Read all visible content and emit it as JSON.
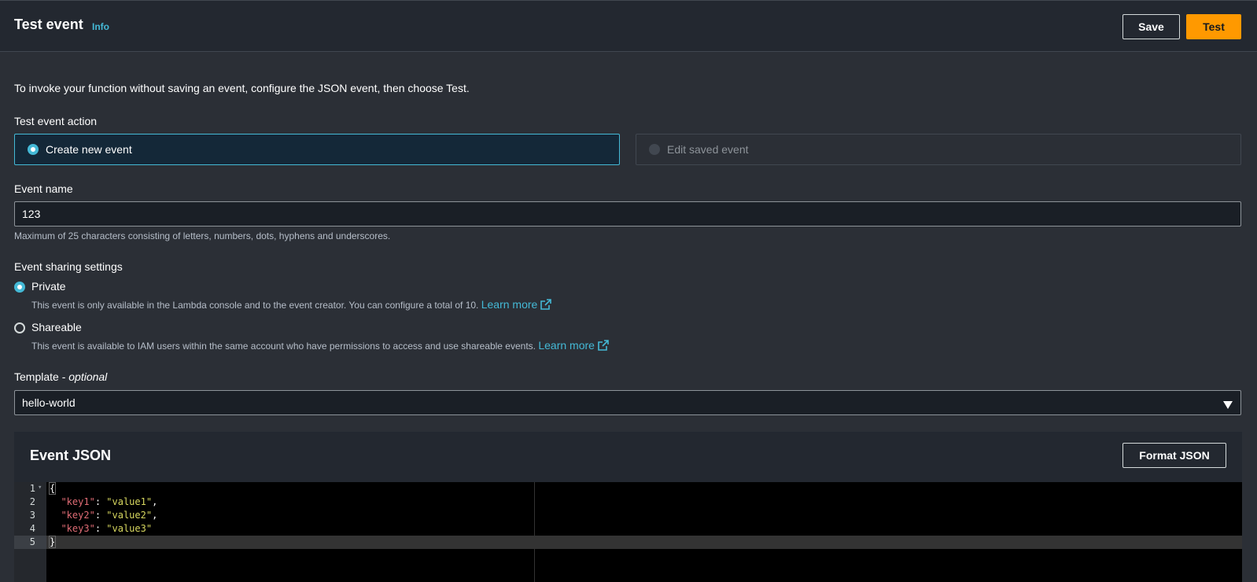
{
  "header": {
    "title": "Test event",
    "info": "Info",
    "save": "Save",
    "test": "Test"
  },
  "intro": "To invoke your function without saving an event, configure the JSON event, then choose Test.",
  "test_event_action": {
    "label": "Test event action",
    "options": [
      "Create new event",
      "Edit saved event"
    ],
    "selected": "Create new event"
  },
  "event_name": {
    "label": "Event name",
    "value": "123",
    "hint": "Maximum of 25 characters consisting of letters, numbers, dots, hyphens and underscores."
  },
  "sharing": {
    "label": "Event sharing settings",
    "options": [
      {
        "label": "Private",
        "description": "This event is only available in the Lambda console and to the event creator. You can configure a total of 10.",
        "link": "Learn more",
        "selected": true
      },
      {
        "label": "Shareable",
        "description": "This event is available to IAM users within the same account who have permissions to access and use shareable events.",
        "link": "Learn more",
        "selected": false
      }
    ]
  },
  "template": {
    "label": "Template - ",
    "label_optional": "optional",
    "value": "hello-world"
  },
  "event_json": {
    "title": "Event JSON",
    "format_button": "Format JSON",
    "line_numbers": [
      "1",
      "2",
      "3",
      "4",
      "5"
    ],
    "lines": [
      {
        "open": "{"
      },
      {
        "key": "\"key1\"",
        "sep": ": ",
        "val": "\"value1\"",
        "end": ","
      },
      {
        "key": "\"key2\"",
        "sep": ": ",
        "val": "\"value2\"",
        "end": ","
      },
      {
        "key": "\"key3\"",
        "sep": ": ",
        "val": "\"value3\"",
        "end": ""
      },
      {
        "close": "}"
      }
    ]
  },
  "colors": {
    "accent": "#44b9d6",
    "primary_button": "#ff9900",
    "background": "#2b2f36",
    "header": "#232830",
    "json_key": "#e06c75",
    "json_string": "#d7d75f"
  }
}
